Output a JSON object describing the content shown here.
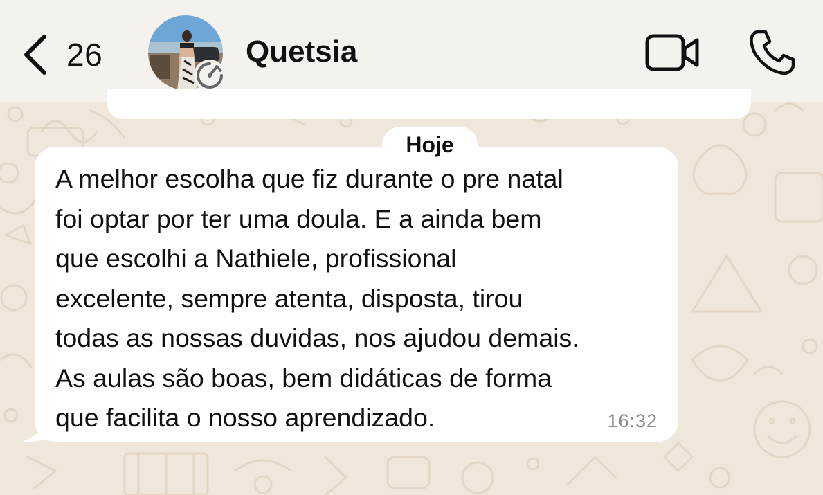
{
  "header": {
    "back_count": "26",
    "contact_name": "Quetsia"
  },
  "chat": {
    "date_label": "Hoje",
    "message": {
      "text": "A melhor escolha que fiz durante o pre natal\nfoi optar por ter uma doula. E a ainda bem\nque escolhi a Nathiele, profissional\nexcelente, sempre atenta, disposta, tirou\ntodas as nossas duvidas, nos ajudou demais.\nAs aulas são boas, bem didáticas de forma\nque facilita o nosso aprendizado.",
      "time": "16:32"
    }
  },
  "icons": {
    "back": "chevron-left-icon",
    "video": "video-camera-icon",
    "call": "phone-icon",
    "avatar_badge": "timer-icon"
  },
  "colors": {
    "header_bg": "#f5f2ee",
    "wallpaper_bg": "#efe7dc",
    "bubble_bg": "#ffffff",
    "text": "#111111",
    "timestamp": "#8a8a8a"
  }
}
